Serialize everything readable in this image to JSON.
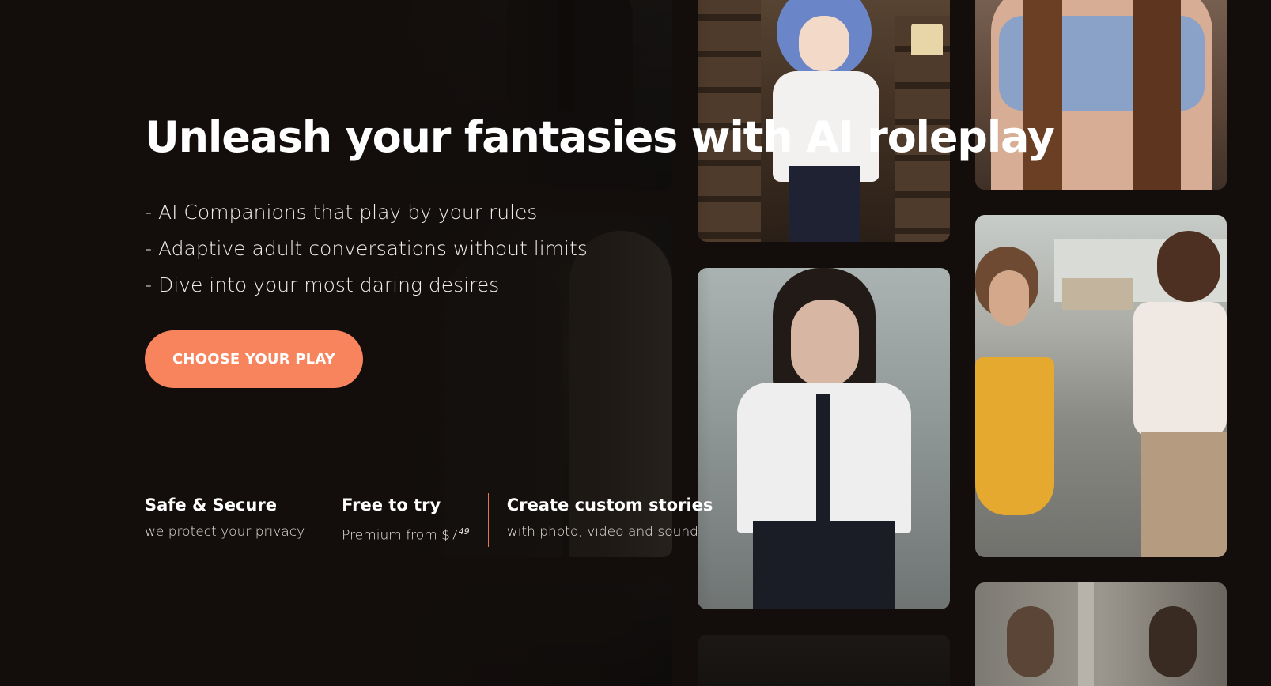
{
  "hero": {
    "title": "Unleash your fantasies with AI roleplay",
    "bullets": [
      "- AI Companions that play by your rules",
      "- Adaptive adult conversations without limits",
      "- Dive into your most daring desires"
    ],
    "cta_label": "CHOOSE YOUR PLAY"
  },
  "features": [
    {
      "title": "Safe & Secure",
      "subtitle": "we protect your privacy"
    },
    {
      "title": "Free to try",
      "subtitle_prefix": "Premium from $7",
      "subtitle_sup": "49"
    },
    {
      "title": "Create custom stories",
      "subtitle": "with photo, video and sound"
    }
  ],
  "colors": {
    "accent": "#f7845d",
    "background": "#130e0c",
    "divider": "#e9754f"
  },
  "gallery": {
    "tiles": [
      {
        "name": "suit-man-photo"
      },
      {
        "name": "blonde-women-photo"
      },
      {
        "name": "dark-photo"
      },
      {
        "name": "anime-librarian-photo"
      },
      {
        "name": "schoolgirl-photo"
      },
      {
        "name": "bottom-photo"
      },
      {
        "name": "blue-top-photo"
      },
      {
        "name": "street-couple-photo"
      },
      {
        "name": "room-couple-photo"
      }
    ]
  }
}
